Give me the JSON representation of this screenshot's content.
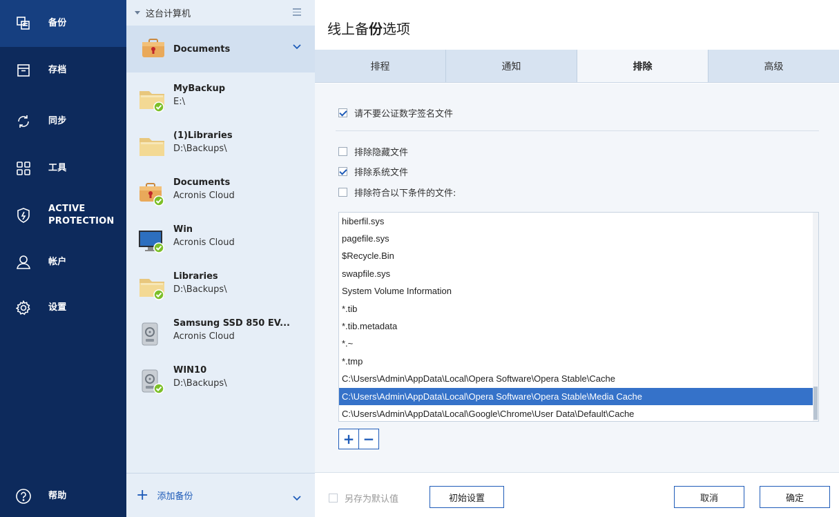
{
  "nav": {
    "items": [
      {
        "label": "备份",
        "icon": "backup-icon"
      },
      {
        "label": "存档",
        "icon": "archive-icon"
      },
      {
        "label": "同步",
        "icon": "sync-icon"
      },
      {
        "label": "工具",
        "icon": "tools-icon"
      },
      {
        "label": "ACTIVE PROTECTION",
        "icon": "shield-icon"
      },
      {
        "label": "帐户",
        "icon": "user-icon"
      },
      {
        "label": "设置",
        "icon": "gear-icon"
      }
    ],
    "help_label": "帮助"
  },
  "backup_list": {
    "header": "这台计算机",
    "items": [
      {
        "name": "Documents",
        "sub": "",
        "icon": "briefcase-icon"
      },
      {
        "name": "MyBackup",
        "sub": "E:\\",
        "icon": "folder-icon"
      },
      {
        "name": "(1)Libraries",
        "sub": "D:\\Backups\\",
        "icon": "folder-icon"
      },
      {
        "name": "Documents",
        "sub": "Acronis Cloud",
        "icon": "briefcase-icon"
      },
      {
        "name": "Win",
        "sub": "Acronis Cloud",
        "icon": "monitor-icon"
      },
      {
        "name": "Libraries",
        "sub": "D:\\Backups\\",
        "icon": "folder-icon"
      },
      {
        "name": "Samsung SSD 850 EV...",
        "sub": "Acronis Cloud",
        "icon": "disk-icon"
      },
      {
        "name": "WIN10",
        "sub": "D:\\Backups\\",
        "icon": "disk-icon"
      }
    ],
    "add_label": "添加备份"
  },
  "main": {
    "title_prefix": "线上备",
    "title_bold": "份",
    "title_suffix": "选项",
    "tabs": [
      "排程",
      "通知",
      "排除",
      "高级"
    ],
    "active_tab": "排除",
    "options": {
      "no_certified": "请不要公证数字签名文件",
      "exclude_hidden": "排除隐藏文件",
      "exclude_system": "排除系统文件",
      "exclude_matching": "排除符合以下条件的文件:"
    },
    "exclusions": [
      "hiberfil.sys",
      "pagefile.sys",
      "$Recycle.Bin",
      "swapfile.sys",
      "System Volume Information",
      "*.tib",
      "*.tib.metadata",
      "*.~",
      "*.tmp",
      "C:\\Users\\Admin\\AppData\\Local\\Opera Software\\Opera Stable\\Cache",
      "C:\\Users\\Admin\\AppData\\Local\\Opera Software\\Opera Stable\\Media Cache",
      "C:\\Users\\Admin\\AppData\\Local\\Google\\Chrome\\User Data\\Default\\Cache"
    ],
    "plus_label": "+",
    "minus_label": "−"
  },
  "footer": {
    "save_default": "另存为默认值",
    "reset": "初始设置",
    "cancel": "取消",
    "ok": "确定"
  },
  "colors": {
    "nav_bg": "#0d2a5c",
    "nav_active": "#163f80",
    "accent": "#1e5bb8",
    "selection": "#3572c9",
    "status_ok": "#7cbf29"
  }
}
